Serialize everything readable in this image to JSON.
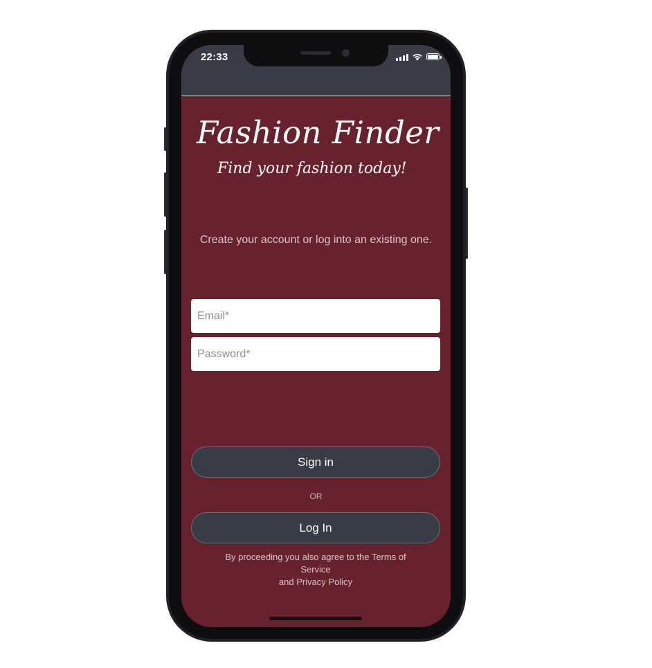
{
  "status_bar": {
    "time": "22:33"
  },
  "app": {
    "title": "Fashion Finder",
    "tagline": "Find your fashion today!"
  },
  "login": {
    "intro": "Create your account or log into an existing one.",
    "email_placeholder": "Email*",
    "password_placeholder": "Password*",
    "sign_in_label": "Sign in",
    "separator": "OR",
    "log_in_label": "Log In",
    "terms_line1": "By proceeding you also agree to the Terms of Service",
    "terms_line2": "and Privacy Policy"
  },
  "colors": {
    "background": "#68222d",
    "header": "#393c46",
    "button": "#393c46",
    "frame": "#212126"
  }
}
